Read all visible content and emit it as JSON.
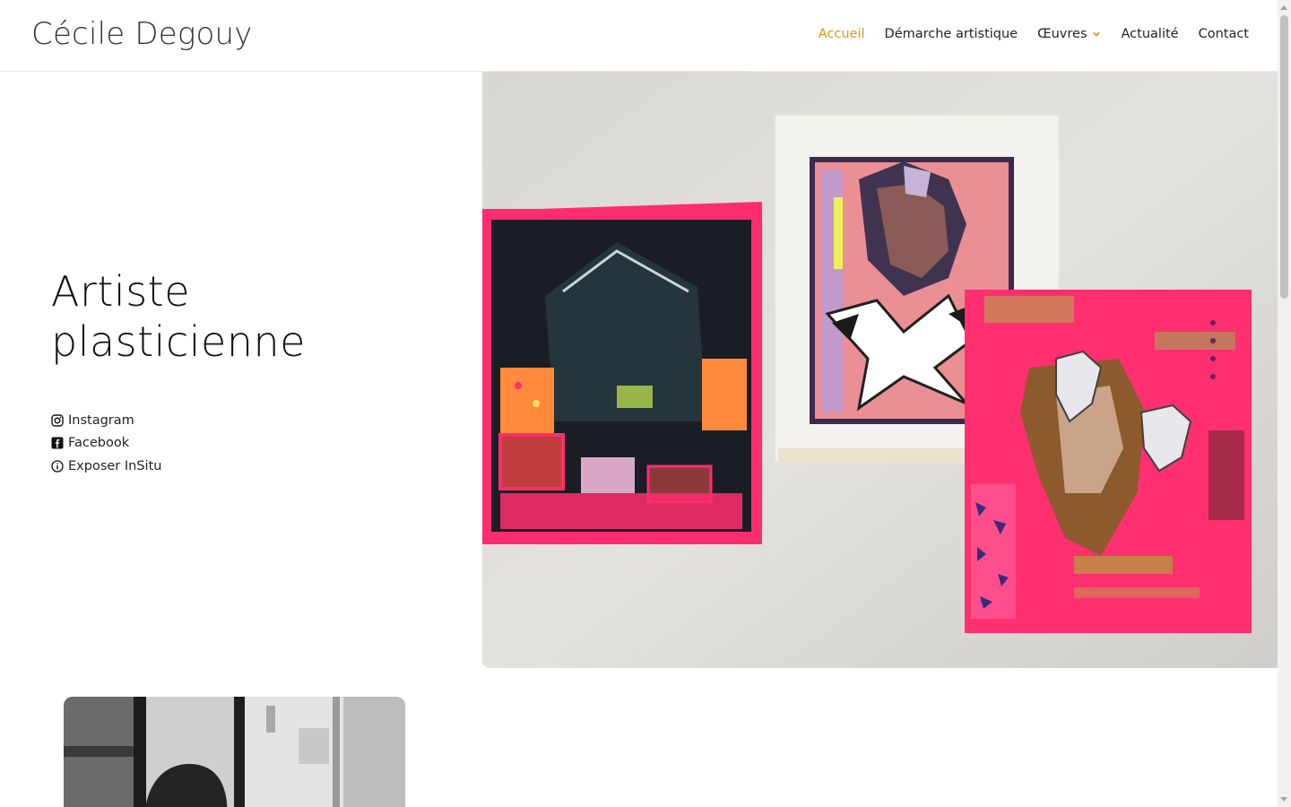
{
  "site": {
    "logo": "Cécile Degouy"
  },
  "nav": {
    "items": [
      {
        "label": "Accueil",
        "active": true
      },
      {
        "label": "Démarche artistique",
        "active": false
      },
      {
        "label": "Œuvres",
        "active": false,
        "has_dropdown": true
      },
      {
        "label": "Actualité",
        "active": false
      },
      {
        "label": "Contact",
        "active": false
      }
    ]
  },
  "hero": {
    "title_line1": "Artiste",
    "title_line2": "plasticienne",
    "links": [
      {
        "label": "Instagram",
        "icon": "instagram-icon"
      },
      {
        "label": "Facebook",
        "icon": "facebook-icon"
      },
      {
        "label": "Exposer InSitu",
        "icon": "info-icon"
      }
    ]
  },
  "colors": {
    "accent": "#d89b0e",
    "text": "#222222",
    "neon_pink": "#ff2d6e"
  }
}
